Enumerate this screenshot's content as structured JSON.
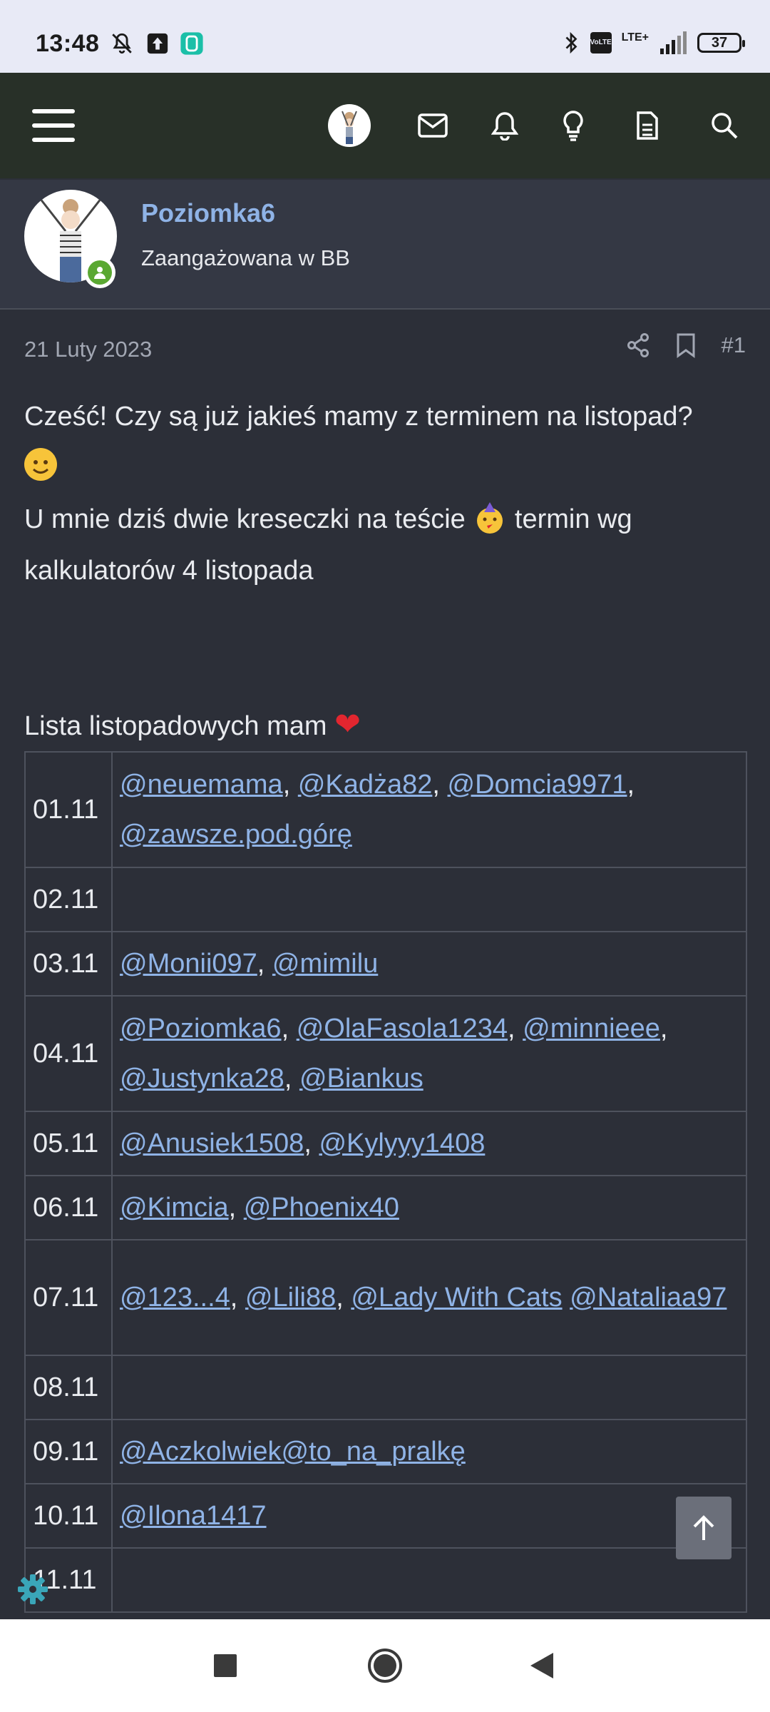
{
  "status": {
    "time": "13:48",
    "lte_label": "VoLTE",
    "network_label": "LTE+",
    "battery": "37"
  },
  "nav": {
    "items": [
      "menu",
      "account",
      "messages",
      "alerts",
      "whats-new",
      "posts",
      "search"
    ]
  },
  "profile": {
    "username": "Poziomka6",
    "title": "Zaangażowana w BB"
  },
  "post": {
    "date": "21 Luty 2023",
    "number": "#1",
    "line1": "Cześć! Czy są już jakieś mamy z terminem na listopad?",
    "line2a": "U mnie dziś dwie kreseczki na teście",
    "line2b": "termin wg",
    "line3": "kalkulatorów 4 listopada",
    "list_title": "Lista listopadowych mam"
  },
  "table": {
    "rows": [
      {
        "date": "01.11",
        "names": [
          "@neuemama",
          "@Kadża82",
          "@Domcia9971",
          "@zawsze.pod.górę"
        ]
      },
      {
        "date": "02.11",
        "names": []
      },
      {
        "date": "03.11",
        "names": [
          "@Monii097",
          "@mimilu"
        ]
      },
      {
        "date": "04.11",
        "names": [
          "@Poziomka6",
          "@OlaFasola1234",
          "@minnieee",
          "@Justynka28",
          "@Biankus"
        ]
      },
      {
        "date": "05.11",
        "names": [
          "@Anusiek1508",
          "@Kylyyy1408"
        ]
      },
      {
        "date": "06.11",
        "names": [
          "@Kimcia",
          "@Phoenix40"
        ]
      },
      {
        "date": "07.11",
        "names": [
          "@123...4",
          "@Lili88",
          "@Lady With Cats",
          "@Nataliaa97"
        ]
      },
      {
        "date": "08.11",
        "names": []
      },
      {
        "date": "09.11",
        "names": [
          "@Aczkolwiek",
          "@to_na_pralkę"
        ]
      },
      {
        "date": "10.11",
        "names": [
          "@Ilona1417"
        ]
      },
      {
        "date": "11.11",
        "names": []
      }
    ]
  },
  "colors": {
    "navbar": "#283028",
    "background": "#2c2f38",
    "link": "#8fb3e6",
    "online": "#5aa832"
  }
}
